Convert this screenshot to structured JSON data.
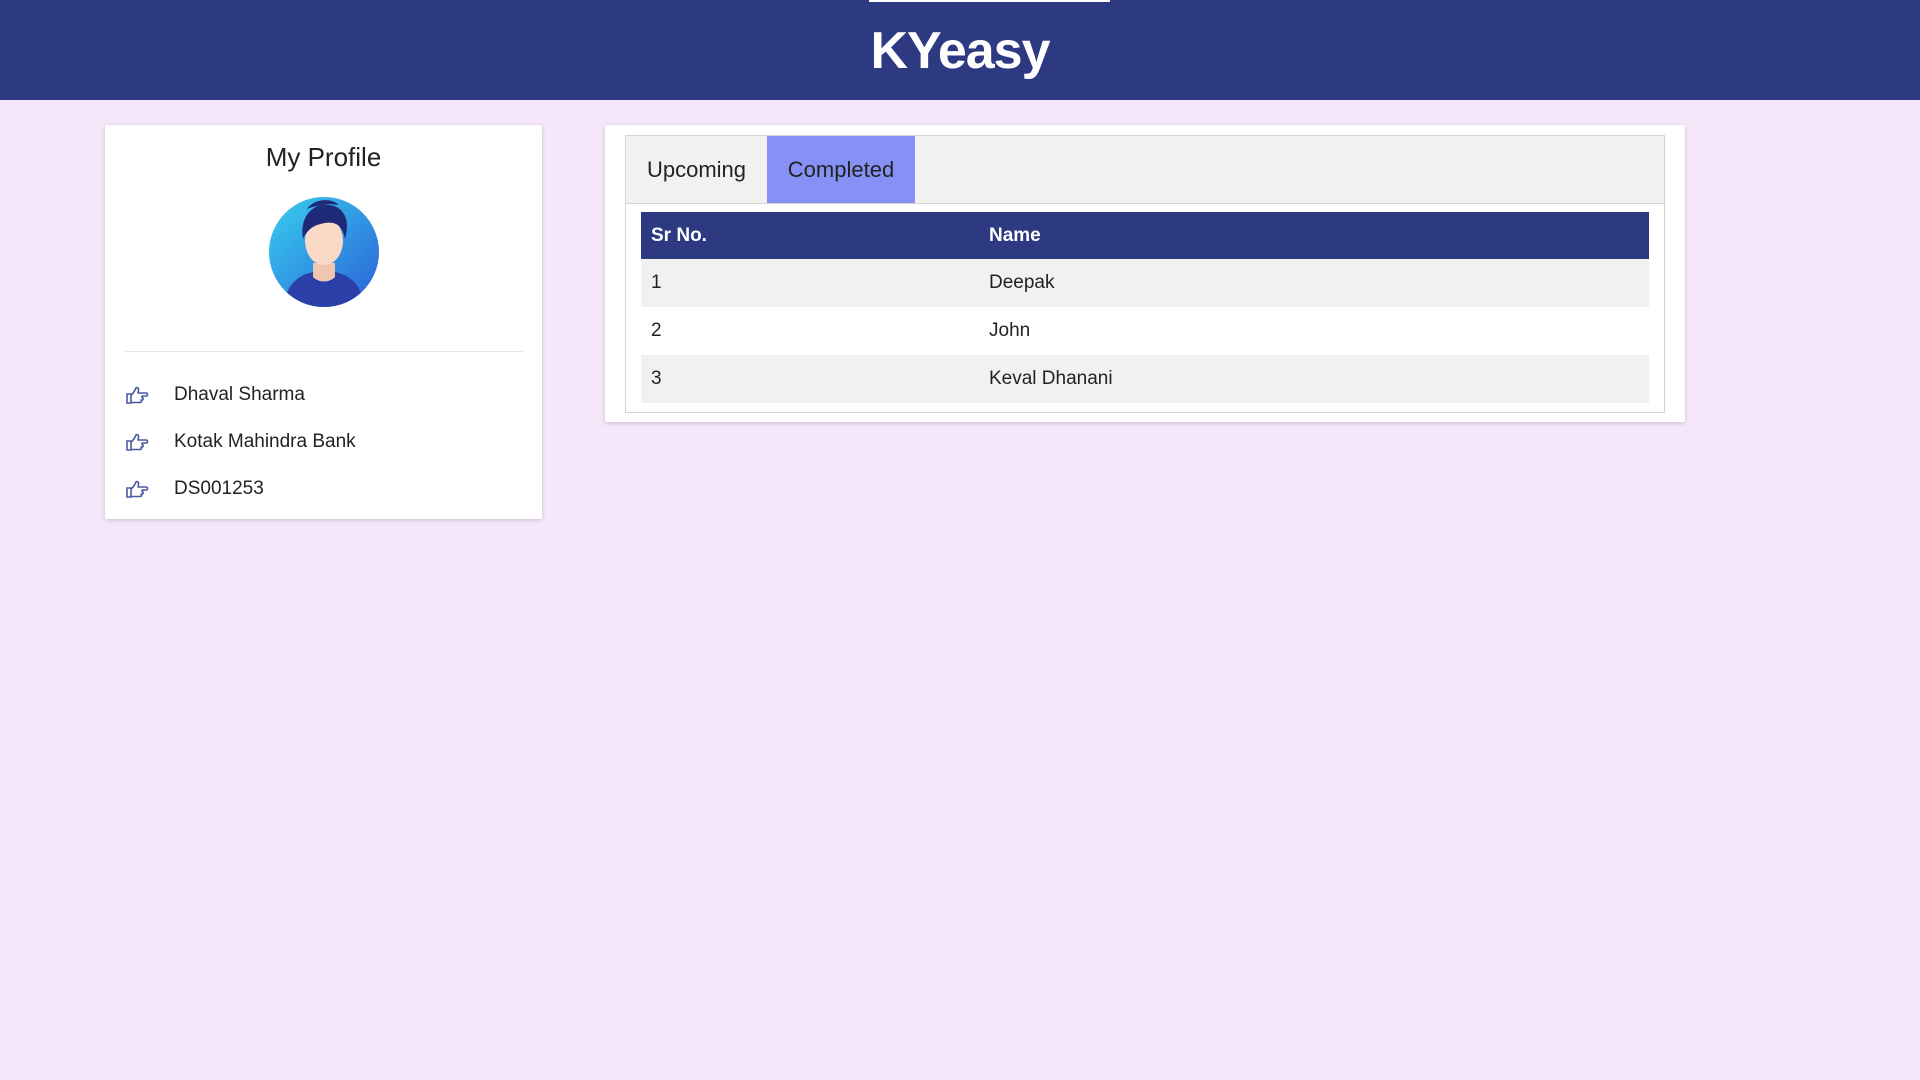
{
  "header": {
    "title": "KYeasy"
  },
  "profile": {
    "title": "My Profile",
    "avatar_icon": "user-avatar-icon",
    "items": [
      {
        "icon": "hand-point-right-icon",
        "label": "Dhaval Sharma"
      },
      {
        "icon": "hand-point-right-icon",
        "label": "Kotak Mahindra Bank"
      },
      {
        "icon": "hand-point-right-icon",
        "label": "DS001253"
      }
    ]
  },
  "tabs": [
    {
      "label": "Upcoming",
      "active": false
    },
    {
      "label": "Completed",
      "active": true
    }
  ],
  "table": {
    "columns": [
      "Sr No.",
      "Name"
    ],
    "rows": [
      [
        "1",
        "Deepak"
      ],
      [
        "2",
        "John"
      ],
      [
        "3",
        "Keval Dhanani"
      ]
    ]
  },
  "colors": {
    "header_bg": "#2d3980",
    "page_bg": "#f5e6fa",
    "active_tab": "#8691f5",
    "icon": "#4a5a9e"
  }
}
